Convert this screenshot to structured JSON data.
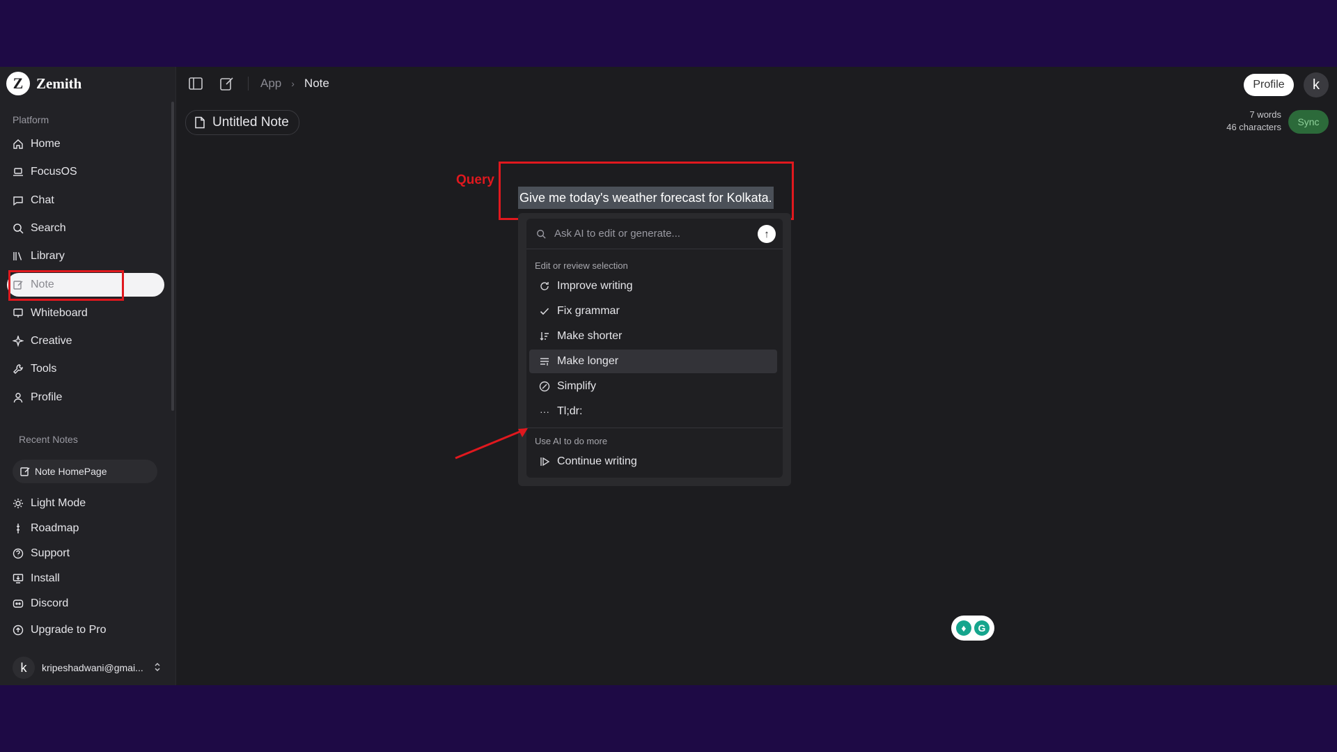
{
  "brand": {
    "logo_letter": "Z",
    "name": "Zemith"
  },
  "sidebar": {
    "platform_label": "Platform",
    "items": [
      {
        "label": "Home",
        "icon": "home-icon"
      },
      {
        "label": "FocusOS",
        "icon": "laptop-icon"
      },
      {
        "label": "Chat",
        "icon": "chat-icon"
      },
      {
        "label": "Search",
        "icon": "search-icon"
      },
      {
        "label": "Library",
        "icon": "library-icon"
      },
      {
        "label": "Note",
        "icon": "note-edit-icon",
        "active": true
      },
      {
        "label": "Whiteboard",
        "icon": "whiteboard-icon"
      },
      {
        "label": "Creative",
        "icon": "sparkle-icon"
      },
      {
        "label": "Tools",
        "icon": "wrench-icon"
      },
      {
        "label": "Profile",
        "icon": "user-icon"
      }
    ],
    "recent_label": "Recent Notes",
    "recent_notes": [
      {
        "label": "Note HomePage"
      }
    ],
    "bottom_items": [
      {
        "label": "Light Mode",
        "icon": "sun-icon"
      },
      {
        "label": "Roadmap",
        "icon": "roadmap-icon"
      },
      {
        "label": "Support",
        "icon": "help-icon"
      },
      {
        "label": "Install",
        "icon": "install-icon"
      },
      {
        "label": "Discord",
        "icon": "discord-icon"
      },
      {
        "label": "Upgrade to Pro",
        "icon": "upgrade-icon"
      }
    ],
    "user": {
      "avatar_letter": "k",
      "email": "kripeshadwani@gmai..."
    }
  },
  "topbar": {
    "breadcrumb": [
      "App",
      "Note"
    ],
    "profile_label": "Profile",
    "avatar_letter": "k"
  },
  "note": {
    "title": "Untitled Note",
    "word_count": "7 words",
    "char_count": "46 characters",
    "sync_label": "Sync",
    "selected_text": "Give me today's weather forecast for Kolkata."
  },
  "annotation": {
    "query_label": "Query"
  },
  "ai_popup": {
    "placeholder": "Ask AI to edit or generate...",
    "group1_label": "Edit or review selection",
    "group1_items": [
      {
        "label": "Improve writing",
        "icon": "refresh-icon"
      },
      {
        "label": "Fix grammar",
        "icon": "check-icon"
      },
      {
        "label": "Make shorter",
        "icon": "shorten-icon"
      },
      {
        "label": "Make longer",
        "icon": "lengthen-icon",
        "hover": true
      },
      {
        "label": "Simplify",
        "icon": "simplify-icon"
      },
      {
        "label": "Tl;dr:",
        "icon": "ellipsis-icon"
      }
    ],
    "group2_label": "Use AI to do more",
    "group2_items": [
      {
        "label": "Continue writing",
        "icon": "play-icon"
      }
    ]
  },
  "colors": {
    "frame_bg": "#1e0a45",
    "app_bg": "#1c1c1f",
    "annotation_red": "#e0181e",
    "sync_green": "#2c6a3a"
  }
}
